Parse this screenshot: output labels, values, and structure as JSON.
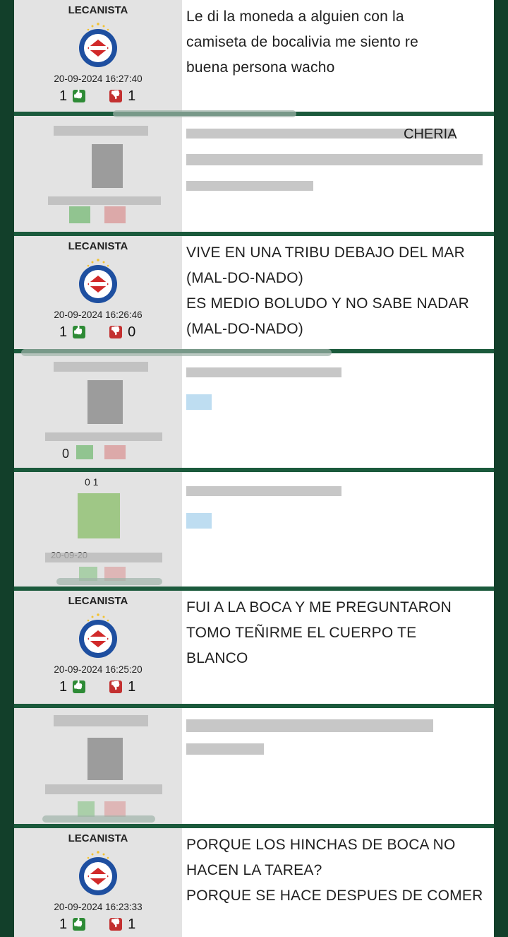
{
  "posts": [
    {
      "user": "LECANISTA",
      "time": "20-09-2024 16:27:40",
      "up": "1",
      "down": "1",
      "text": "Le di la moneda a alguien con la\ncamiseta de bocalivia me siento re\nbuena persona wacho"
    },
    {
      "user": "LECANISTA",
      "time": "20-09-2024 16:26:46",
      "up": "1",
      "down": "0",
      "text": "VIVE EN UNA TRIBU DEBAJO DEL MAR\n(MAL-DO-NADO)\nES MEDIO BOLUDO Y NO SABE NADAR\n(MAL-DO-NADO)"
    },
    {
      "user": "LECANISTA",
      "time": "20-09-2024 16:25:20",
      "up": "1",
      "down": "1",
      "text": "FUI A LA BOCA Y ME PREGUNTARON\nTOMO TEÑIRME EL CUERPO TE\nBLANCO"
    },
    {
      "user": "LECANISTA",
      "time": "20-09-2024 16:23:33",
      "up": "1",
      "down": "1",
      "text": "PORQUE LOS HINCHAS DE BOCA NO\nHACEN LA TAREA?\nPORQUE SE HACE DESPUES DE COMER"
    }
  ],
  "redacted_fragments": {
    "r1_text": "CHERIA",
    "r2_votes": "0",
    "r3_date": "20-09-20",
    "r3_score": "0 1"
  },
  "colors": {
    "frame": "#1b5a3c",
    "user_bg": "#e3e3e3",
    "upvote": "#2e8b36",
    "downvote": "#c33030"
  }
}
